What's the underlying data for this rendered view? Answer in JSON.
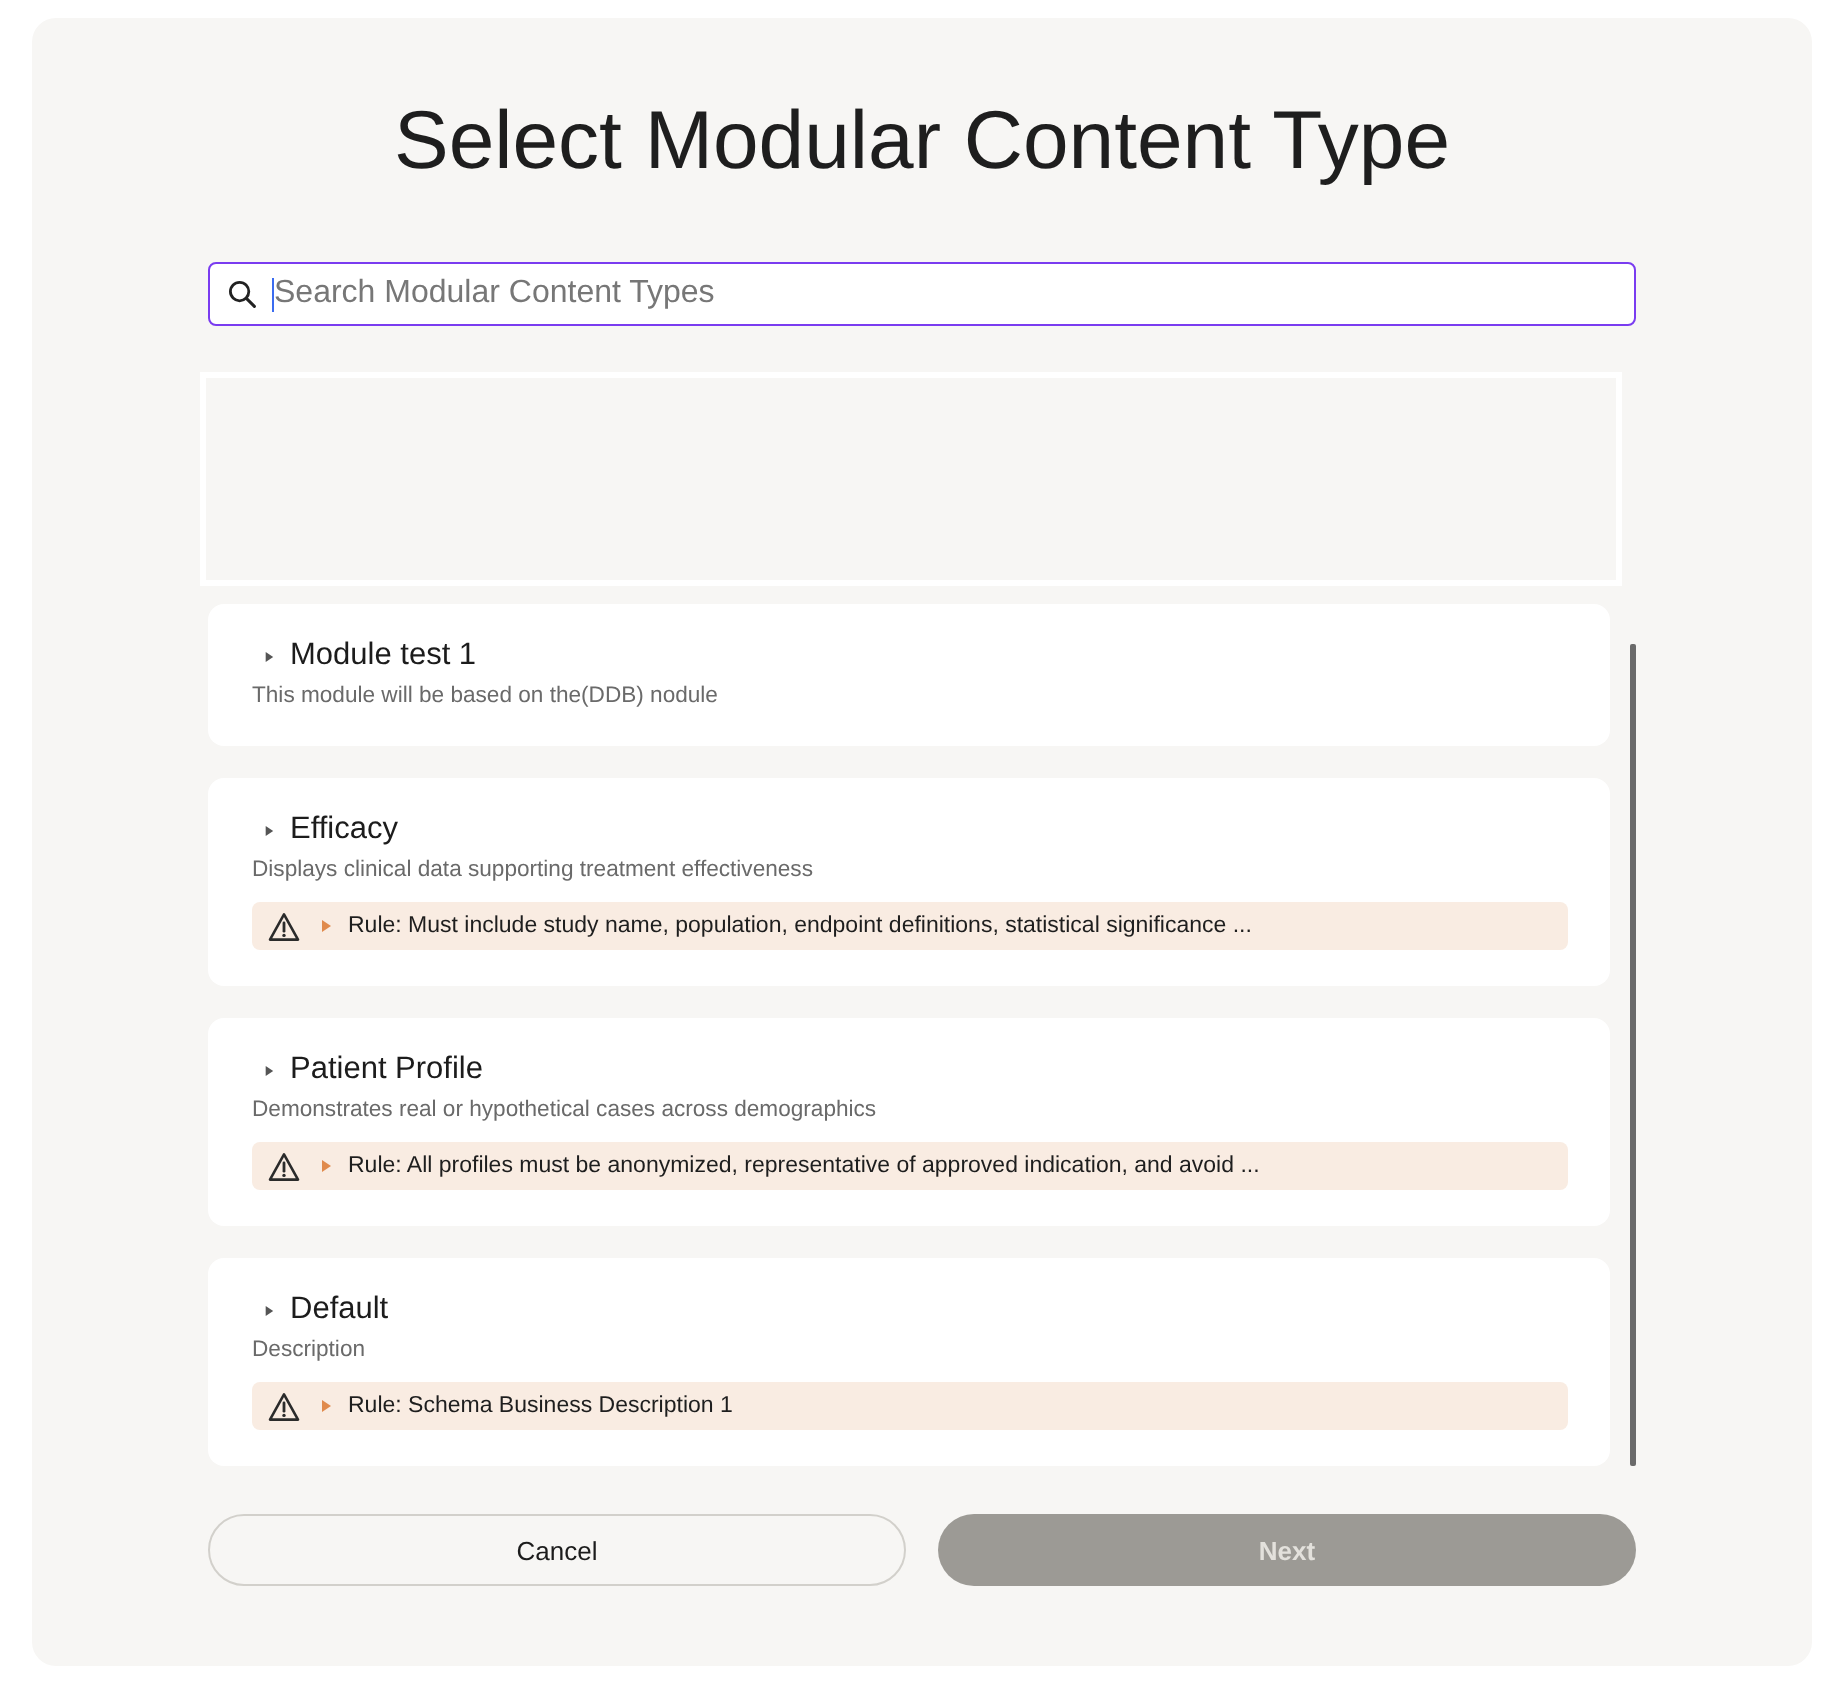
{
  "title": "Select Modular Content Type",
  "search": {
    "placeholder": "Search Modular Content Types",
    "focused": true
  },
  "modules": [
    {
      "title": "Module test 1",
      "description": "This module will be based on the(DDB) nodule",
      "expanded": false
    },
    {
      "title": "Efficacy",
      "description": "Displays clinical data supporting treatment effectiveness",
      "expanded": false,
      "rule": {
        "text": "Rule: Must include study name, population, endpoint definitions, statistical significance ...",
        "expanded": false
      }
    },
    {
      "title": "Patient Profile",
      "description": "Demonstrates real or hypothetical cases across demographics",
      "expanded": false,
      "rule": {
        "text": "Rule: All profiles must be anonymized, representative of approved indication, and avoid ...",
        "expanded": false
      }
    },
    {
      "title": "Default",
      "description": "Description",
      "expanded": false,
      "rule": {
        "text": "Rule: Schema Business Description 1",
        "expanded": false
      }
    }
  ],
  "buttons": [
    {
      "label": "Cancel",
      "kind": "secondary",
      "disabled": false
    },
    {
      "label": "Next",
      "kind": "primary",
      "disabled": true
    }
  ]
}
